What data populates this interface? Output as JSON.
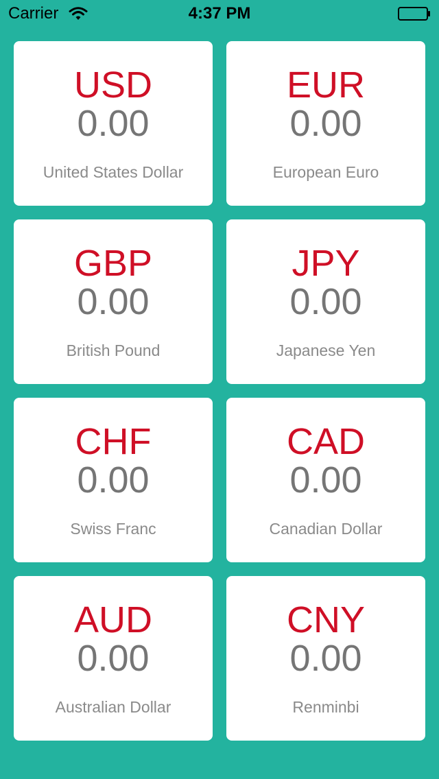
{
  "status_bar": {
    "carrier": "Carrier",
    "time": "4:37 PM",
    "wifi_icon": "wifi-icon",
    "battery_icon": "battery-icon"
  },
  "colors": {
    "background": "#23b39f",
    "card": "#ffffff",
    "code": "#cf0f26",
    "amount": "#757575",
    "name": "#8a8a8a"
  },
  "currencies": [
    {
      "code": "USD",
      "amount": "0.00",
      "name": "United States Dollar"
    },
    {
      "code": "EUR",
      "amount": "0.00",
      "name": "European Euro"
    },
    {
      "code": "GBP",
      "amount": "0.00",
      "name": "British Pound"
    },
    {
      "code": "JPY",
      "amount": "0.00",
      "name": "Japanese Yen"
    },
    {
      "code": "CHF",
      "amount": "0.00",
      "name": "Swiss Franc"
    },
    {
      "code": "CAD",
      "amount": "0.00",
      "name": "Canadian Dollar"
    },
    {
      "code": "AUD",
      "amount": "0.00",
      "name": "Australian Dollar"
    },
    {
      "code": "CNY",
      "amount": "0.00",
      "name": "Renminbi"
    }
  ]
}
